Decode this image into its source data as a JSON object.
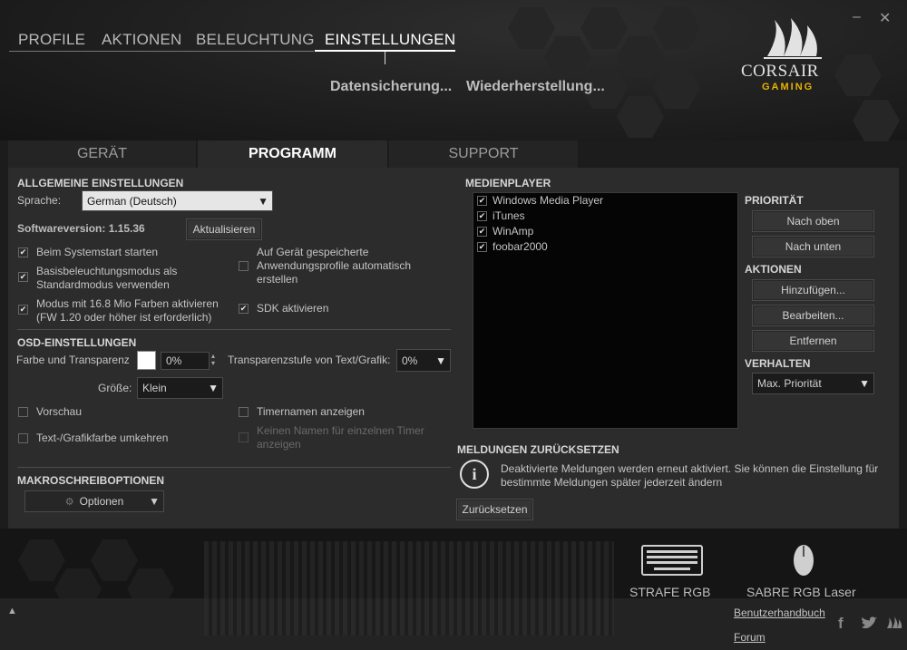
{
  "window": {
    "minimize_glyph": "–",
    "close_glyph": "✕"
  },
  "top_nav": {
    "tabs": [
      "PROFILE",
      "AKTIONEN",
      "BELEUCHTUNG",
      "EINSTELLUNGEN"
    ],
    "active": "EINSTELLUNGEN"
  },
  "sub_nav": {
    "backup": "Datensicherung...",
    "restore": "Wiederherstellung..."
  },
  "logo": {
    "brand": "CORSAIR",
    "sub": "GAMING",
    "accent_color": "#e6b400",
    "icon": "corsair-sails-icon"
  },
  "settings_tabs": [
    "GERÄT",
    "PROGRAMM",
    "SUPPORT"
  ],
  "settings_active": "PROGRAMM",
  "general": {
    "title": "ALLGEMEINE EINSTELLUNGEN",
    "language_label": "Sprache:",
    "language_value": "German (Deutsch)",
    "version_label": "Softwareversion: 1.15.36",
    "update_button": "Aktualisieren",
    "options": [
      {
        "label": "Beim Systemstart starten",
        "checked": true
      },
      {
        "label": "Basisbeleuchtungsmodus als Standardmodus verwenden",
        "checked": true
      },
      {
        "label": "Modus mit 16.8 Mio Farben aktivieren (FW 1.20 oder höher ist erforderlich)",
        "checked": true
      },
      {
        "label": "Auf Gerät gespeicherte Anwendungsprofile automatisch erstellen",
        "checked": false
      },
      {
        "label": "SDK aktivieren",
        "checked": true
      }
    ],
    "check_glyph": "✔"
  },
  "osd": {
    "title": "OSD-EINSTELLUNGEN",
    "color_label": "Farbe und Transparenz",
    "color_swatch": "#ffffff",
    "transparency_value": "0%",
    "text_transparency_label": "Transparenzstufe von Text/Grafik:",
    "text_transparency_value": "0%",
    "size_label": "Größe:",
    "size_value": "Klein",
    "preview_label": "Vorschau",
    "invert_label": "Text-/Grafikfarbe umkehren",
    "timer_names_label": "Timernamen anzeigen",
    "no_name_label": "Keinen Namen für einzelnen Timer anzeigen"
  },
  "macro": {
    "title": "MAKROSCHREIBOPTIONEN",
    "options_button": "Optionen"
  },
  "media": {
    "title": "MEDIENPLAYER",
    "players": [
      {
        "name": "Windows Media Player",
        "checked": true
      },
      {
        "name": "iTunes",
        "checked": true
      },
      {
        "name": "WinAmp",
        "checked": true
      },
      {
        "name": "foobar2000",
        "checked": true
      }
    ],
    "priority_title": "PRIORITÄT",
    "move_up": "Nach oben",
    "move_down": "Nach unten",
    "actions_title": "AKTIONEN",
    "add": "Hinzufügen...",
    "edit": "Bearbeiten...",
    "remove": "Entfernen",
    "behavior_title": "VERHALTEN",
    "behavior_value": "Max. Priorität"
  },
  "reset": {
    "title": "MELDUNGEN ZURÜCKSETZEN",
    "message": "Deaktivierte Meldungen werden erneut aktiviert. Sie können die Einstellung für bestimmte Meldungen später jederzeit ändern",
    "button": "Zurücksetzen",
    "info_glyph": "i"
  },
  "devices": [
    {
      "name": "STRAFE RGB",
      "icon": "keyboard-icon"
    },
    {
      "name": "SABRE RGB Laser",
      "icon": "mouse-icon"
    }
  ],
  "footer": {
    "manual": "Benutzerhandbuch",
    "forum": "Forum",
    "collapse_glyph": "▲",
    "facebook_glyph": "f",
    "twitter_glyph": "🐦"
  }
}
